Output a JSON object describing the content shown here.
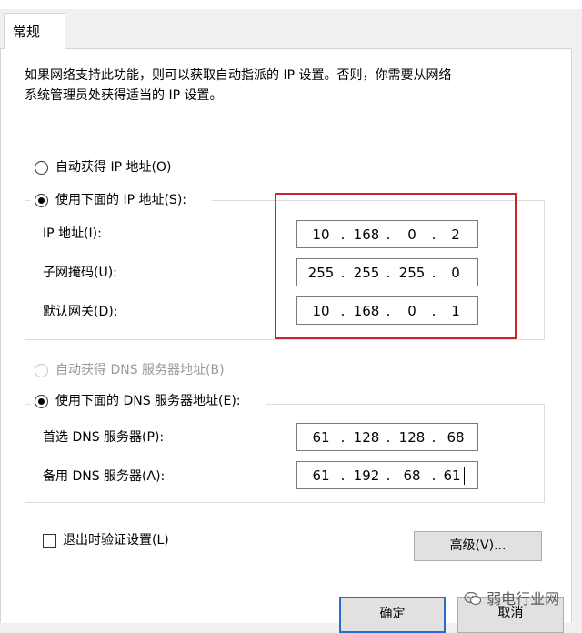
{
  "tab_label": "常规",
  "description_line1": "如果网络支持此功能，则可以获取自动指派的 IP 设置。否则，你需要从网络",
  "description_line2": "系统管理员处获得适当的 IP 设置。",
  "ip_mode": {
    "auto_label": "自动获得 IP 地址(O)",
    "manual_label": "使用下面的 IP 地址(S):",
    "selected": "manual"
  },
  "ip_fields": {
    "ip_label": "IP 地址(I):",
    "ip_octets": [
      "10",
      "168",
      "0",
      "2"
    ],
    "mask_label": "子网掩码(U):",
    "mask_octets": [
      "255",
      "255",
      "255",
      "0"
    ],
    "gateway_label": "默认网关(D):",
    "gateway_octets": [
      "10",
      "168",
      "0",
      "1"
    ]
  },
  "dns_mode": {
    "auto_label": "自动获得 DNS 服务器地址(B)",
    "manual_label": "使用下面的 DNS 服务器地址(E):",
    "selected": "manual"
  },
  "dns_fields": {
    "preferred_label": "首选 DNS 服务器(P):",
    "preferred_octets": [
      "61",
      "128",
      "128",
      "68"
    ],
    "alternate_label": "备用 DNS 服务器(A):",
    "alternate_octets": [
      "61",
      "192",
      "68",
      "61"
    ]
  },
  "validate_on_exit": {
    "label": "退出时验证设置(L)",
    "checked": false
  },
  "buttons": {
    "advanced": "高级(V)...",
    "ok": "确定",
    "cancel": "取消"
  },
  "watermark_text": "弱电行业网",
  "icon_names": {
    "watermark": "wechat-icon"
  },
  "colors": {
    "highlight": "#c9252d",
    "primary_border": "#2a6bd1"
  }
}
